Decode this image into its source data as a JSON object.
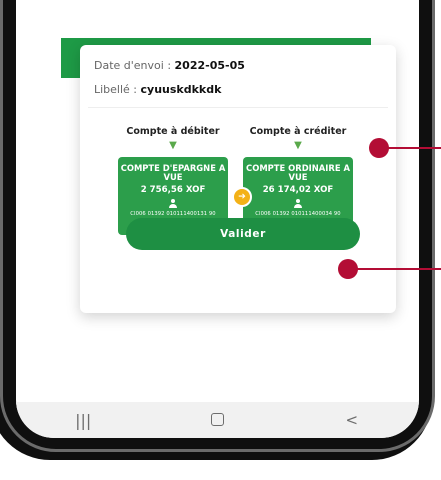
{
  "transfer": {
    "date_label": "Date d'envoi : ",
    "date_value": "2022-05-05",
    "libelle_label": "Libellé : ",
    "libelle_value": "cyuuskdkkdk"
  },
  "accounts": {
    "debit_heading": "Compte à débiter",
    "credit_heading": "Compte à créditer",
    "debit": {
      "type": "COMPTE D'EPARGNE A VUE",
      "amount": "2 756,56 XOF",
      "number": "CI006 01392 010111400131 90"
    },
    "credit": {
      "type": "COMPTE ORDINAIRE A VUE",
      "amount": "26 174,02 XOF",
      "number": "CI006 01392 010111400034 90"
    }
  },
  "actions": {
    "valider_label": "Valider"
  },
  "nav": {
    "recents": "|||",
    "back": "<"
  },
  "colors": {
    "brand_green": "#1e9a46",
    "transfer_icon": "#f3b117",
    "callout": "#b30d35"
  },
  "icons": [
    "arrow-down-icon",
    "transfer-arrow-icon",
    "user-icon",
    "home-icon"
  ]
}
